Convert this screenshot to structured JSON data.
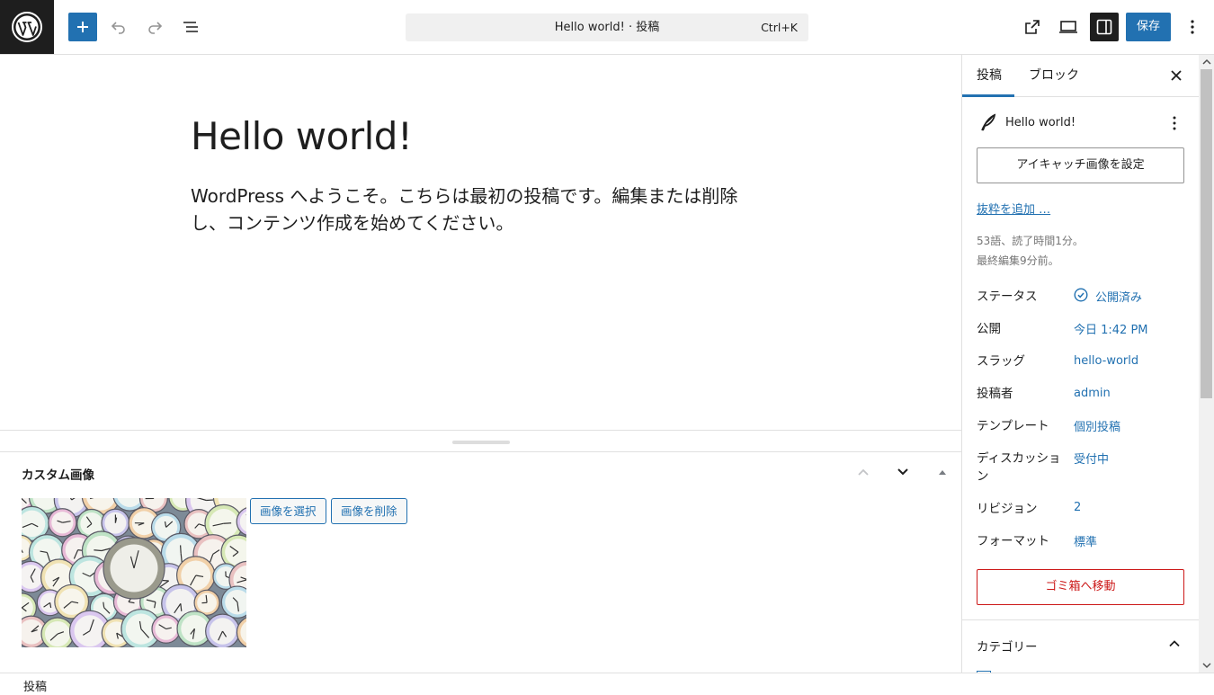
{
  "topbar": {
    "document_title": "Hello world! · 投稿",
    "shortcut": "Ctrl+K",
    "save_label": "保存"
  },
  "editor": {
    "title": "Hello world!",
    "body": "WordPress へようこそ。こちらは最初の投稿です。編集または削除し、コンテンツ作成を始めてください。"
  },
  "metabox": {
    "title": "カスタム画像",
    "select_label": "画像を選択",
    "remove_label": "画像を削除"
  },
  "footer": {
    "breadcrumb": "投稿"
  },
  "sidebar": {
    "tabs": [
      {
        "label": "投稿",
        "active": true
      },
      {
        "label": "ブロック",
        "active": false
      }
    ],
    "summary_title": "Hello world!",
    "featured_image_label": "アイキャッチ画像を設定",
    "excerpt_link": "抜粋を追加 …",
    "word_count": "53語、読了時間1分。",
    "last_edited": "最終編集9分前。",
    "rows": [
      {
        "label": "ステータス",
        "value": "公開済み"
      },
      {
        "label": "公開",
        "value": "今日 1:42 PM"
      },
      {
        "label": "スラッグ",
        "value": "hello-world"
      },
      {
        "label": "投稿者",
        "value": "admin"
      },
      {
        "label": "テンプレート",
        "value": "個別投稿"
      },
      {
        "label": "ディスカッション",
        "value": "受付中"
      },
      {
        "label": "リビジョン",
        "value": "2"
      },
      {
        "label": "フォーマット",
        "value": "標準"
      }
    ],
    "trash_label": "ゴミ箱へ移動",
    "category_title": "カテゴリー"
  },
  "colors": {
    "accent": "#2271b1",
    "dark": "#1e1e1e",
    "danger": "#cc1818"
  }
}
